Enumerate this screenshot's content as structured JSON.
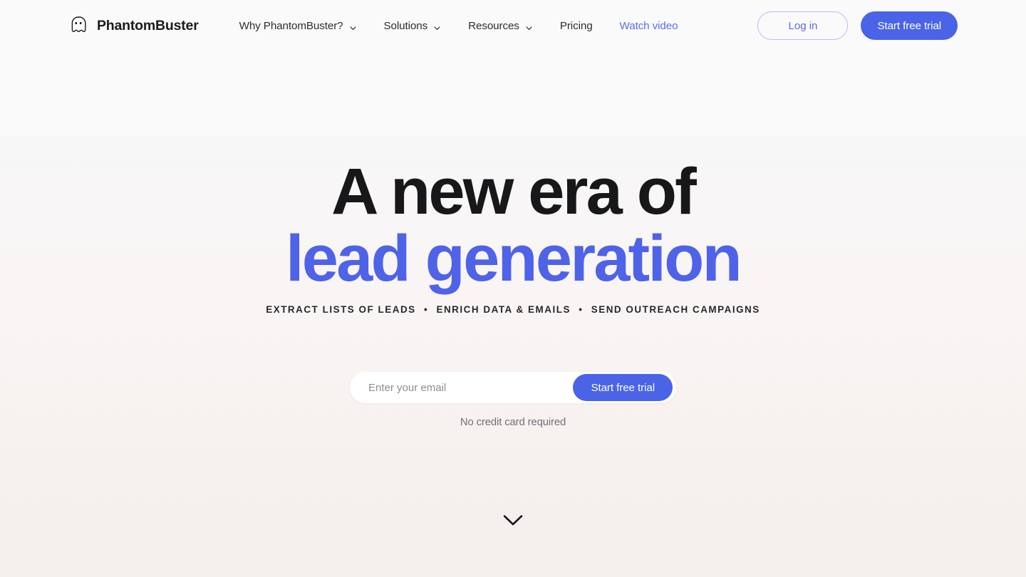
{
  "brand": {
    "name": "PhantomBuster",
    "logo_icon": "ghost-icon"
  },
  "nav": {
    "items": [
      {
        "label": "Why PhantomBuster?",
        "has_dropdown": true,
        "accent": false,
        "icon": "chevron-down-icon"
      },
      {
        "label": "Solutions",
        "has_dropdown": true,
        "accent": false,
        "icon": "chevron-down-icon"
      },
      {
        "label": "Resources",
        "has_dropdown": true,
        "accent": false,
        "icon": "chevron-down-icon"
      },
      {
        "label": "Pricing",
        "has_dropdown": false,
        "accent": false,
        "icon": ""
      },
      {
        "label": "Watch video",
        "has_dropdown": false,
        "accent": true,
        "icon": ""
      }
    ],
    "login_label": "Log in",
    "trial_label": "Start free trial"
  },
  "hero": {
    "headline_line1": "A new era of",
    "headline_line2": "lead generation",
    "tagline_parts": [
      "EXTRACT LISTS OF LEADS",
      "ENRICH DATA & EMAILS",
      "SEND OUTREACH CAMPAIGNS"
    ],
    "tagline_separator": "•",
    "email_placeholder": "Enter your email",
    "email_value": "",
    "cta_label": "Start free trial",
    "disclaimer": "No credit card required",
    "scroll_icon": "chevron-down-icon"
  },
  "colors": {
    "accent": "#4a63e7",
    "headline_blue": "#4f63e8",
    "headline_dark": "#18181b",
    "login_border": "#b9bdf0",
    "page_top_bg": "#fafafa",
    "hero_bg_start": "#f7f7f8",
    "hero_bg_end": "#f4efed"
  }
}
